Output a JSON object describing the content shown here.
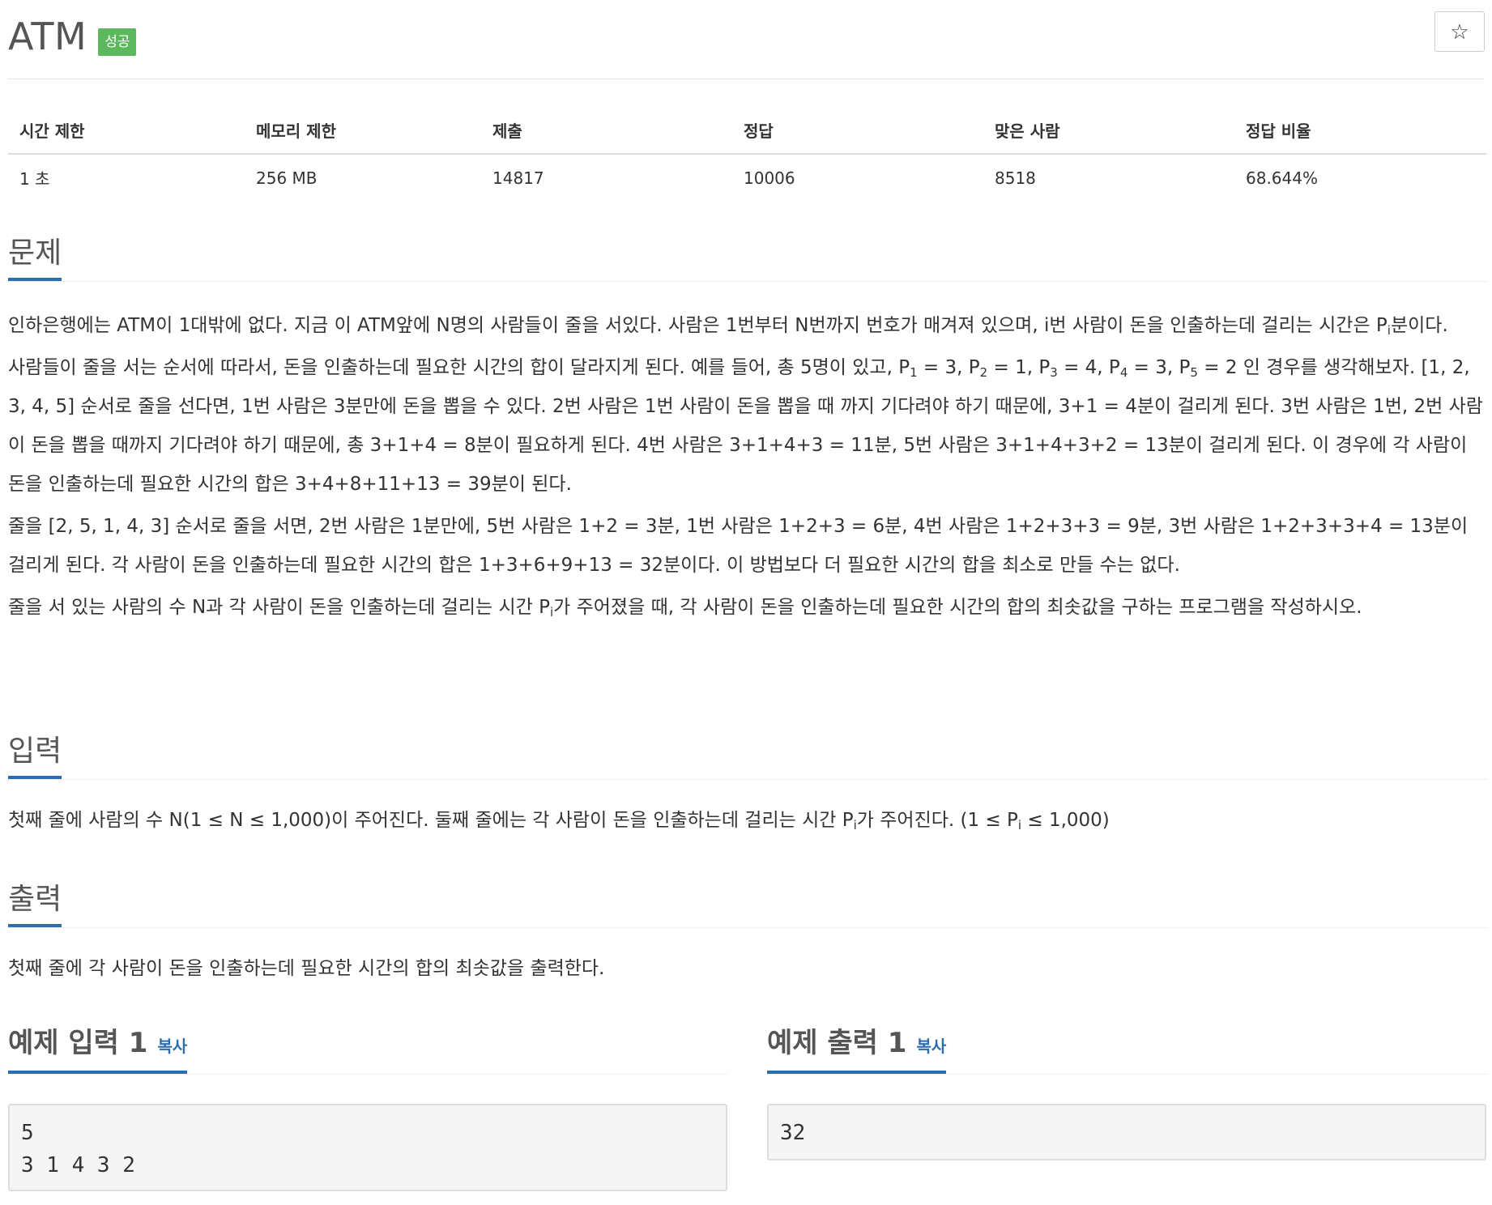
{
  "header": {
    "title": "ATM",
    "badge": "성공",
    "star": "☆"
  },
  "info_table": {
    "headers": [
      "시간 제한",
      "메모리 제한",
      "제출",
      "정답",
      "맞은 사람",
      "정답 비율"
    ],
    "values": [
      "1 초",
      "256 MB",
      "14817",
      "10006",
      "8518",
      "68.644%"
    ]
  },
  "problem": {
    "title": "문제",
    "p1_a": "인하은행에는 ATM이 1대밖에 없다. 지금 이 ATM앞에 N명의 사람들이 줄을 서있다. 사람은 1번부터 N번까지 번호가 매겨져 있으며, i번 사람이 돈을 인출하는데 걸리는 시간은 P",
    "p1_sub": "i",
    "p1_b": "분이다.",
    "p2_a": "사람들이 줄을 서는 순서에 따라서, 돈을 인출하는데 필요한 시간의 합이 달라지게 된다. 예를 들어, 총 5명이 있고, P",
    "p2_s1": "1",
    "p2_b": " = 3, P",
    "p2_s2": "2",
    "p2_c": " = 1, P",
    "p2_s3": "3",
    "p2_d": " = 4, P",
    "p2_s4": "4",
    "p2_e": " = 3, P",
    "p2_s5": "5",
    "p2_f": " = 2 인 경우를 생각해보자. [1, 2, 3, 4, 5] 순서로 줄을 선다면, 1번 사람은 3분만에 돈을 뽑을 수 있다. 2번 사람은 1번 사람이 돈을 뽑을 때 까지 기다려야 하기 때문에, 3+1 = 4분이 걸리게 된다. 3번 사람은 1번, 2번 사람이 돈을 뽑을 때까지 기다려야 하기 때문에, 총 3+1+4 = 8분이 필요하게 된다. 4번 사람은 3+1+4+3 = 11분, 5번 사람은 3+1+4+3+2 = 13분이 걸리게 된다. 이 경우에 각 사람이 돈을 인출하는데 필요한 시간의 합은 3+4+8+11+13 = 39분이 된다.",
    "p3": "줄을 [2, 5, 1, 4, 3] 순서로 줄을 서면, 2번 사람은 1분만에, 5번 사람은 1+2 = 3분, 1번 사람은 1+2+3 = 6분, 4번 사람은 1+2+3+3 = 9분, 3번 사람은 1+2+3+3+4 = 13분이 걸리게 된다. 각 사람이 돈을 인출하는데 필요한 시간의 합은 1+3+6+9+13 = 32분이다. 이 방법보다 더 필요한 시간의 합을 최소로 만들 수는 없다.",
    "p4_a": "줄을 서 있는 사람의 수 N과 각 사람이 돈을 인출하는데 걸리는 시간 P",
    "p4_sub": "i",
    "p4_b": "가 주어졌을 때, 각 사람이 돈을 인출하는데 필요한 시간의 합의 최솟값을 구하는 프로그램을 작성하시오."
  },
  "input": {
    "title": "입력",
    "text_a": "첫째 줄에 사람의 수 N(1 ≤ N ≤ 1,000)이 주어진다. 둘째 줄에는 각 사람이 돈을 인출하는데 걸리는 시간 P",
    "sub1": "i",
    "text_b": "가 주어진다. (1 ≤ P",
    "sub2": "i",
    "text_c": " ≤ 1,000)"
  },
  "output": {
    "title": "출력",
    "text": "첫째 줄에 각 사람이 돈을 인출하는데 필요한 시간의 합의 최솟값을 출력한다."
  },
  "sample_input": {
    "title": "예제 입력 1",
    "copy": "복사",
    "content": "5\n3 1 4 3 2"
  },
  "sample_output": {
    "title": "예제 출력 1",
    "copy": "복사",
    "content": "32"
  },
  "colors": {
    "accent": "#2b6db1",
    "badge": "#5cb85c"
  }
}
